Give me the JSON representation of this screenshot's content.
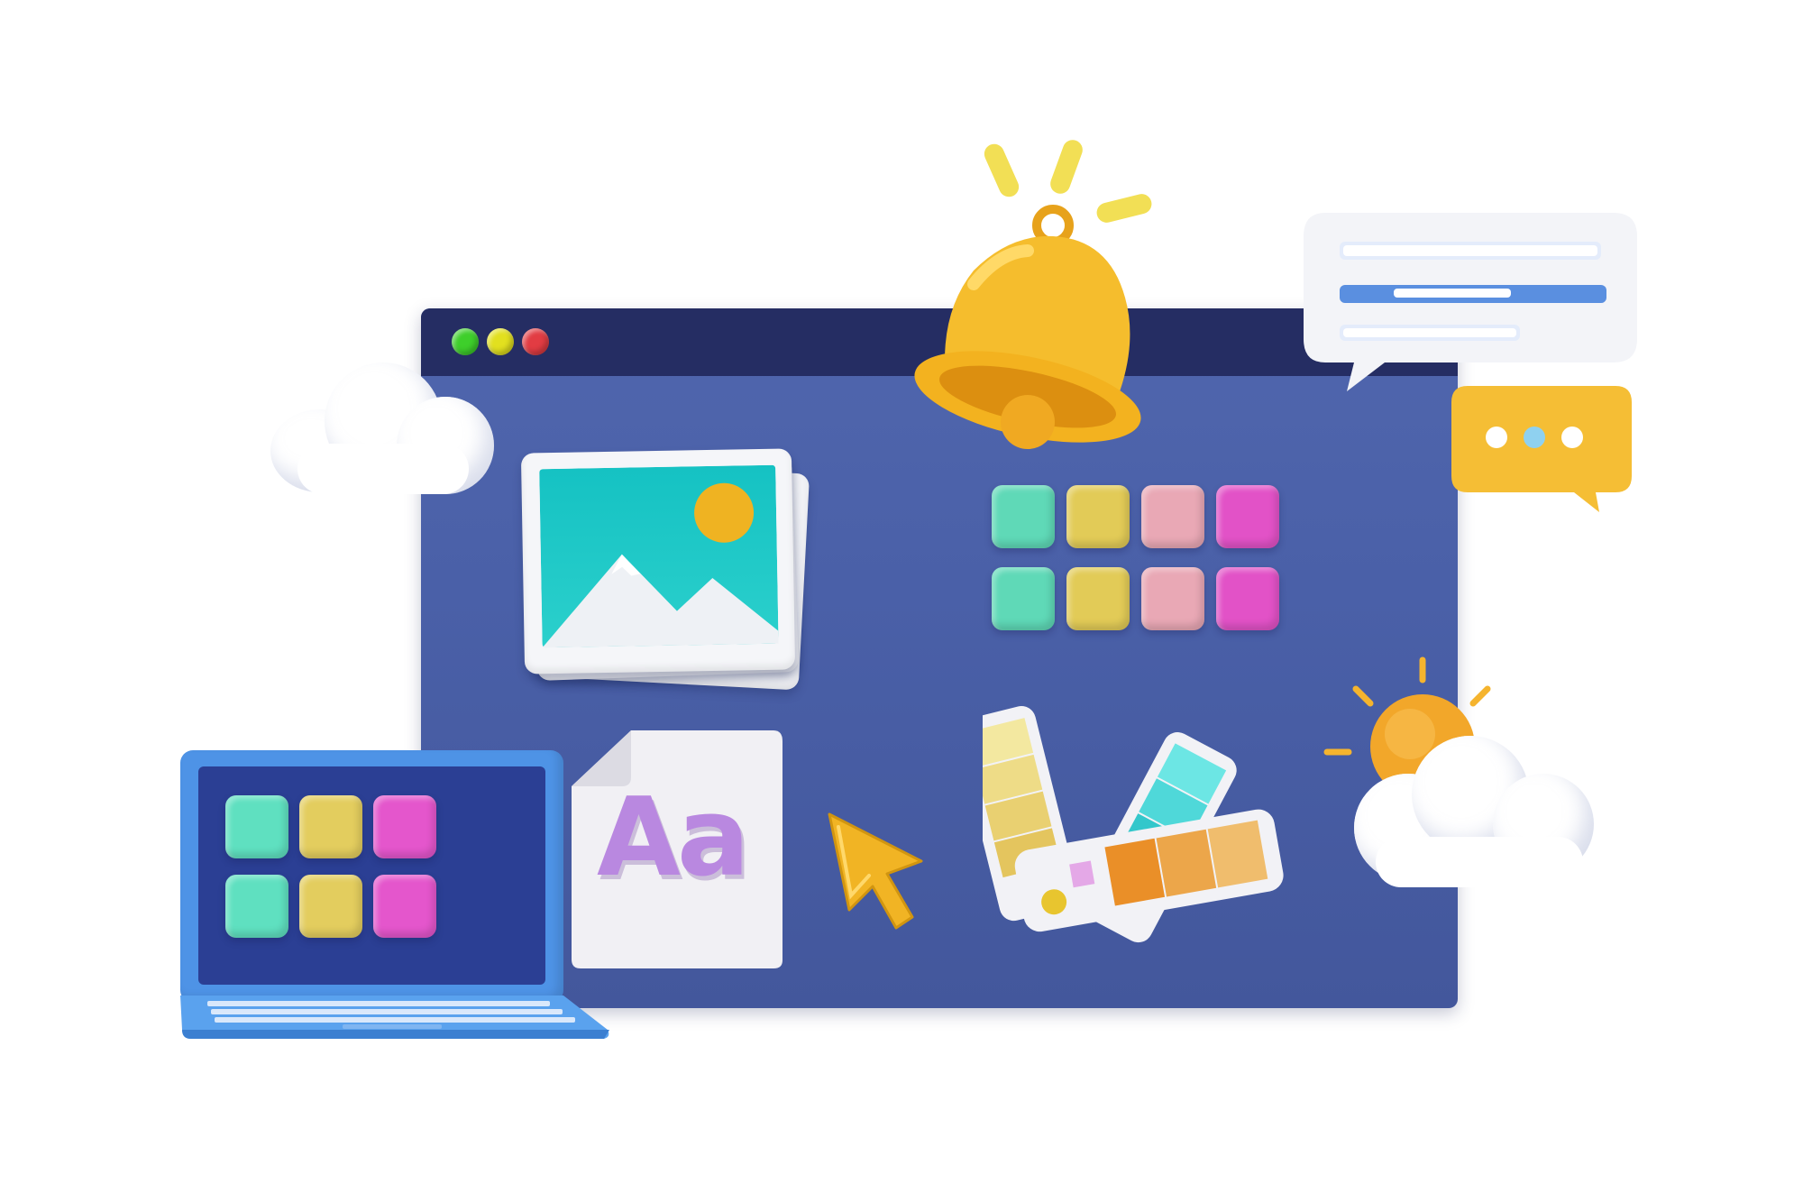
{
  "window": {
    "title_bar_dots": [
      "#3ecf2b",
      "#e2e01f",
      "#e23c43"
    ]
  },
  "font_card": {
    "specimen_text": "Aa"
  },
  "colors": {
    "window_bg": "#4a60a8",
    "title_bar": "#252d63",
    "teal": "#5fd9b7",
    "yellow": "#e2cb57",
    "pink": "#e9a8b5",
    "magenta": "#e252c7",
    "bell": "#f5bd2d",
    "laptop": "#4e93e6",
    "font_purple": "#b988e0"
  },
  "swatch_grid": {
    "rows": [
      [
        "#5fd9b7",
        "#e2cb57",
        "#e9a8b5",
        "#e252c7"
      ],
      [
        "#5fd9b7",
        "#e2cb57",
        "#e9a8b5",
        "#e252c7"
      ]
    ]
  },
  "laptop_grid": {
    "rows": [
      [
        "#5fe0c0",
        "#e3cd5e",
        "#e456cc"
      ],
      [
        "#5fe0c0",
        "#e3cd5e",
        "#e456cc"
      ]
    ]
  },
  "icons": [
    "bell-icon",
    "cloud-icon",
    "image-icon",
    "swatch-grid",
    "font-file-icon",
    "cursor-icon",
    "color-palette-icon",
    "sun-cloud-icon",
    "chat-bubble-icon",
    "typing-bubble-icon",
    "laptop-icon"
  ]
}
